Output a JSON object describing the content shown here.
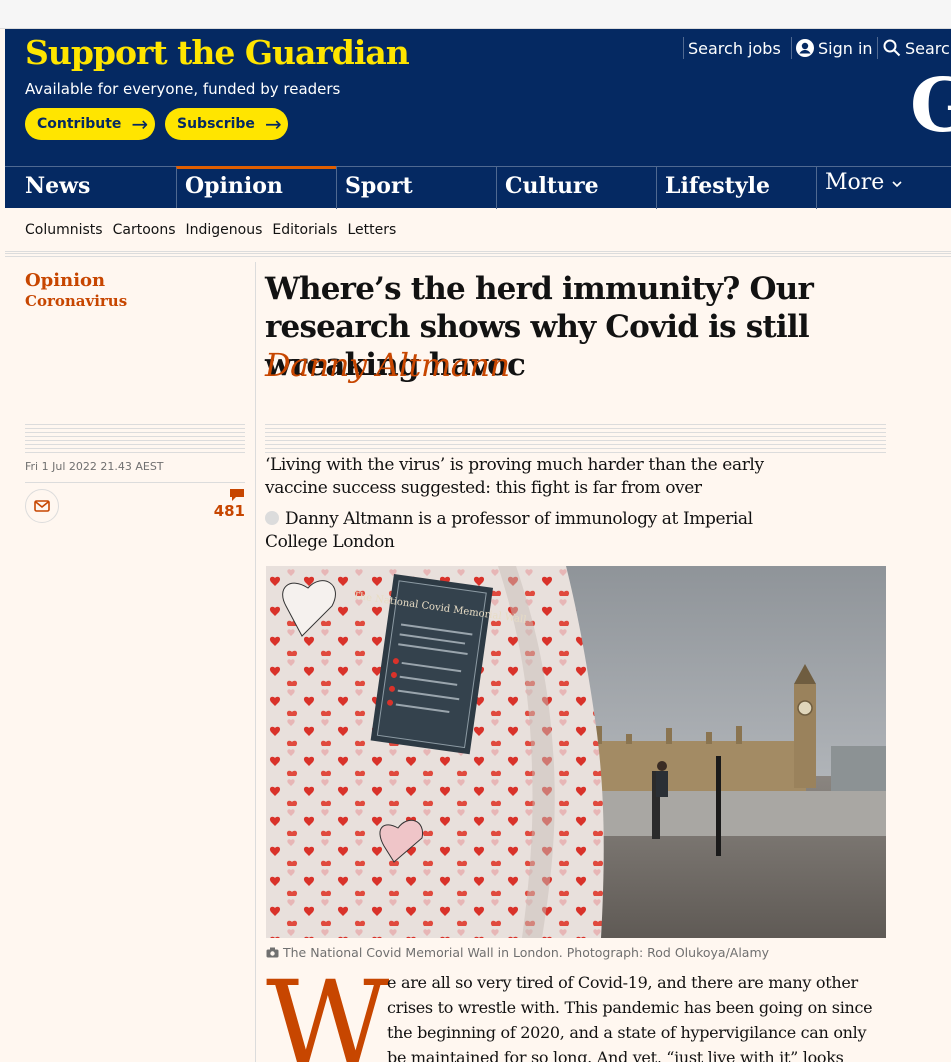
{
  "masthead": {
    "support_title": "Support the Guardian",
    "support_sub": "Available for everyone, funded by readers",
    "contribute_label": "Contribute",
    "subscribe_label": "Subscribe",
    "search_jobs_label": "Search jobs",
    "sign_in_label": "Sign in",
    "search_label": "Search",
    "logo_letter": "G",
    "brand_color": "#052962",
    "accent_color": "#ffe500"
  },
  "pillars": {
    "news": "News",
    "opinion": "Opinion",
    "sport": "Sport",
    "culture": "Culture",
    "lifestyle": "Lifestyle",
    "more": "More"
  },
  "subnav": {
    "items": [
      "Columnists",
      "Cartoons",
      "Indigenous",
      "Editorials",
      "Letters"
    ]
  },
  "article": {
    "section": "Opinion",
    "series": "Coronavirus",
    "dateline": "Fri 1 Jul 2022 21.43 AEST",
    "comment_count": "481",
    "headline": "Where’s the herd immunity? Our research shows why Covid is still wreaking havoc",
    "byline": "Danny Altmann",
    "standfirst": "‘Living with the virus’ is proving much harder than the early vaccine success suggested: this fight is far from over",
    "bio": "Danny Altmann is a professor of immunology at Imperial College London",
    "caption": "The National Covid Memorial Wall in London. Photograph: Rod Olukoya/Alamy",
    "photo_plaque_title": "The National Covid Memorial Wall",
    "dropcap": "W",
    "body_text": "e are all so very tired of Covid-19, and there are many other crises to wrestle with. This pandemic has been going on since the beginning of 2020, and a state of hypervigilance can only be maintained for so long. And yet, “just live with it” looks",
    "opinion_color": "#c74600"
  }
}
